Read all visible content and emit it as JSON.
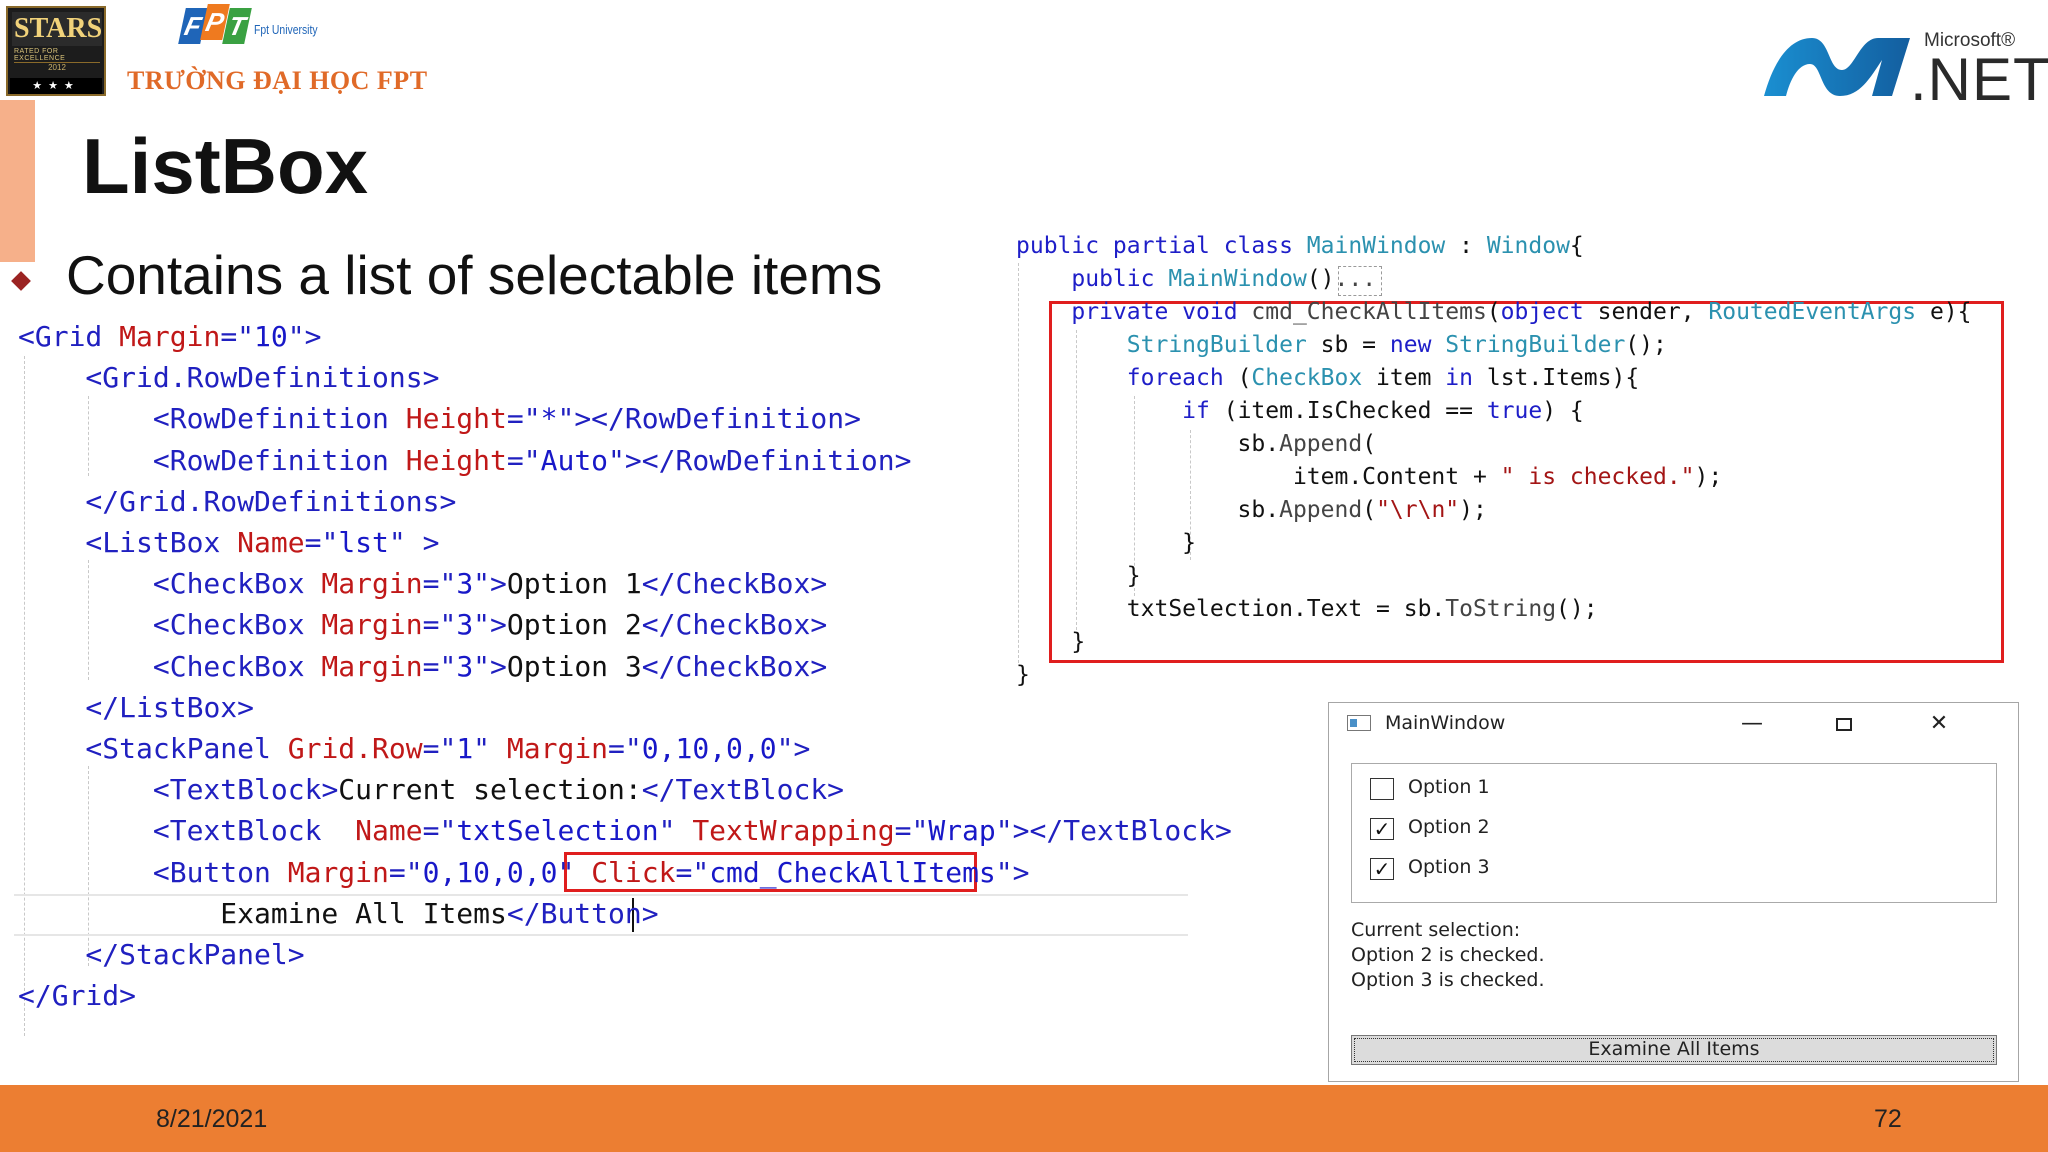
{
  "header": {
    "stars_logo": {
      "text": "STARS",
      "subtext": "RATED FOR EXCELLENCE",
      "year": "2012",
      "stars": "★★★"
    },
    "fpt_logo": {
      "letters": [
        "F",
        "P",
        "T"
      ],
      "university": "Fpt University",
      "school_name": "TRƯỜNG ĐẠI HỌC FPT"
    },
    "dotnet_logo": {
      "company": "Microsoft®",
      "product": ".NET"
    }
  },
  "slide": {
    "title": "ListBox",
    "bullet": "Contains a list of selectable items"
  },
  "xaml_code": [
    [
      {
        "t": "<",
        "c": "tg"
      },
      {
        "t": "Grid",
        "c": "tg"
      },
      {
        "t": " Margin",
        "c": "an"
      },
      {
        "t": "=\"",
        "c": "tg"
      },
      {
        "t": "10",
        "c": "av"
      },
      {
        "t": "\">",
        "c": "tg"
      }
    ],
    [
      {
        "t": "    <",
        "c": "tg"
      },
      {
        "t": "Grid.RowDefinitions",
        "c": "tg"
      },
      {
        "t": ">",
        "c": "tg"
      }
    ],
    [
      {
        "t": "        <",
        "c": "tg"
      },
      {
        "t": "RowDefinition",
        "c": "tg"
      },
      {
        "t": " Height",
        "c": "an"
      },
      {
        "t": "=\"",
        "c": "tg"
      },
      {
        "t": "*",
        "c": "av"
      },
      {
        "t": "\"></",
        "c": "tg"
      },
      {
        "t": "RowDefinition",
        "c": "tg"
      },
      {
        "t": ">",
        "c": "tg"
      }
    ],
    [
      {
        "t": "        <",
        "c": "tg"
      },
      {
        "t": "RowDefinition",
        "c": "tg"
      },
      {
        "t": " Height",
        "c": "an"
      },
      {
        "t": "=\"",
        "c": "tg"
      },
      {
        "t": "Auto",
        "c": "av"
      },
      {
        "t": "\"></",
        "c": "tg"
      },
      {
        "t": "RowDefinition",
        "c": "tg"
      },
      {
        "t": ">",
        "c": "tg"
      }
    ],
    [
      {
        "t": "    </",
        "c": "tg"
      },
      {
        "t": "Grid.RowDefinitions",
        "c": "tg"
      },
      {
        "t": ">",
        "c": "tg"
      }
    ],
    [
      {
        "t": "    <",
        "c": "tg"
      },
      {
        "t": "ListBox",
        "c": "tg"
      },
      {
        "t": " Name",
        "c": "an"
      },
      {
        "t": "=\"",
        "c": "tg"
      },
      {
        "t": "lst",
        "c": "av"
      },
      {
        "t": "\" >",
        "c": "tg"
      }
    ],
    [
      {
        "t": "        <",
        "c": "tg"
      },
      {
        "t": "CheckBox",
        "c": "tg"
      },
      {
        "t": " Margin",
        "c": "an"
      },
      {
        "t": "=\"",
        "c": "tg"
      },
      {
        "t": "3",
        "c": "av"
      },
      {
        "t": "\">",
        "c": "tg"
      },
      {
        "t": "Option 1",
        "c": "tx"
      },
      {
        "t": "</",
        "c": "tg"
      },
      {
        "t": "CheckBox",
        "c": "tg"
      },
      {
        "t": ">",
        "c": "tg"
      }
    ],
    [
      {
        "t": "        <",
        "c": "tg"
      },
      {
        "t": "CheckBox",
        "c": "tg"
      },
      {
        "t": " Margin",
        "c": "an"
      },
      {
        "t": "=\"",
        "c": "tg"
      },
      {
        "t": "3",
        "c": "av"
      },
      {
        "t": "\">",
        "c": "tg"
      },
      {
        "t": "Option 2",
        "c": "tx"
      },
      {
        "t": "</",
        "c": "tg"
      },
      {
        "t": "CheckBox",
        "c": "tg"
      },
      {
        "t": ">",
        "c": "tg"
      }
    ],
    [
      {
        "t": "        <",
        "c": "tg"
      },
      {
        "t": "CheckBox",
        "c": "tg"
      },
      {
        "t": " Margin",
        "c": "an"
      },
      {
        "t": "=\"",
        "c": "tg"
      },
      {
        "t": "3",
        "c": "av"
      },
      {
        "t": "\">",
        "c": "tg"
      },
      {
        "t": "Option 3",
        "c": "tx"
      },
      {
        "t": "</",
        "c": "tg"
      },
      {
        "t": "CheckBox",
        "c": "tg"
      },
      {
        "t": ">",
        "c": "tg"
      }
    ],
    [
      {
        "t": "    </",
        "c": "tg"
      },
      {
        "t": "ListBox",
        "c": "tg"
      },
      {
        "t": ">",
        "c": "tg"
      }
    ],
    [
      {
        "t": "    <",
        "c": "tg"
      },
      {
        "t": "StackPanel",
        "c": "tg"
      },
      {
        "t": " Grid.Row",
        "c": "an"
      },
      {
        "t": "=\"",
        "c": "tg"
      },
      {
        "t": "1",
        "c": "av"
      },
      {
        "t": "\"",
        "c": "tg"
      },
      {
        "t": " Margin",
        "c": "an"
      },
      {
        "t": "=\"",
        "c": "tg"
      },
      {
        "t": "0,10,0,0",
        "c": "av"
      },
      {
        "t": "\">",
        "c": "tg"
      }
    ],
    [
      {
        "t": "        <",
        "c": "tg"
      },
      {
        "t": "TextBlock",
        "c": "tg"
      },
      {
        "t": ">",
        "c": "tg"
      },
      {
        "t": "Current selection:",
        "c": "tx"
      },
      {
        "t": "</",
        "c": "tg"
      },
      {
        "t": "TextBlock",
        "c": "tg"
      },
      {
        "t": ">",
        "c": "tg"
      }
    ],
    [
      {
        "t": "        <",
        "c": "tg"
      },
      {
        "t": "TextBlock",
        "c": "tg"
      },
      {
        "t": "  Name",
        "c": "an"
      },
      {
        "t": "=\"",
        "c": "tg"
      },
      {
        "t": "txtSelection",
        "c": "av"
      },
      {
        "t": "\"",
        "c": "tg"
      },
      {
        "t": " TextWrapping",
        "c": "an"
      },
      {
        "t": "=\"",
        "c": "tg"
      },
      {
        "t": "Wrap",
        "c": "av"
      },
      {
        "t": "\"></",
        "c": "tg"
      },
      {
        "t": "TextBlock",
        "c": "tg"
      },
      {
        "t": ">",
        "c": "tg"
      }
    ],
    [
      {
        "t": "        <",
        "c": "tg"
      },
      {
        "t": "Button",
        "c": "tg"
      },
      {
        "t": " Margin",
        "c": "an"
      },
      {
        "t": "=\"",
        "c": "tg"
      },
      {
        "t": "0,10,0,0",
        "c": "av"
      },
      {
        "t": "\" ",
        "c": "tg"
      },
      {
        "t": "Click",
        "c": "an"
      },
      {
        "t": "=\"",
        "c": "tg"
      },
      {
        "t": "cmd_CheckAllItems",
        "c": "av"
      },
      {
        "t": "\"",
        "c": "tg"
      },
      {
        "t": ">",
        "c": "tg"
      }
    ],
    [
      {
        "t": "            Examine All Items",
        "c": "tx"
      },
      {
        "t": "</",
        "c": "tg"
      },
      {
        "t": "Button",
        "c": "tg"
      },
      {
        "t": ">",
        "c": "tg"
      }
    ],
    [
      {
        "t": "    </",
        "c": "tg"
      },
      {
        "t": "StackPanel",
        "c": "tg"
      },
      {
        "t": ">",
        "c": "tg"
      }
    ],
    [
      {
        "t": "</",
        "c": "tg"
      },
      {
        "t": "Grid",
        "c": "tg"
      },
      {
        "t": ">",
        "c": "tg"
      }
    ]
  ],
  "csharp_code": [
    [
      {
        "t": "public partial class ",
        "c": "kw"
      },
      {
        "t": "MainWindow",
        "c": "ty"
      },
      {
        "t": " : ",
        "c": "tx"
      },
      {
        "t": "Window",
        "c": "ty"
      },
      {
        "t": "{",
        "c": "tx"
      }
    ],
    [
      {
        "t": "    public ",
        "c": "kw"
      },
      {
        "t": "MainWindow",
        "c": "ty"
      },
      {
        "t": "()",
        "c": "tx"
      },
      {
        "t": "...",
        "c": "me"
      }
    ],
    [
      {
        "t": "    private void ",
        "c": "kw"
      },
      {
        "t": "cmd_CheckAllItems",
        "c": "me"
      },
      {
        "t": "(",
        "c": "tx"
      },
      {
        "t": "object",
        "c": "kw"
      },
      {
        "t": " sender, ",
        "c": "tx"
      },
      {
        "t": "RoutedEventArgs",
        "c": "ty"
      },
      {
        "t": " e){",
        "c": "tx"
      }
    ],
    [
      {
        "t": "        ",
        "c": "tx"
      },
      {
        "t": "StringBuilder",
        "c": "ty"
      },
      {
        "t": " sb = ",
        "c": "tx"
      },
      {
        "t": "new ",
        "c": "kw"
      },
      {
        "t": "StringBuilder",
        "c": "ty"
      },
      {
        "t": "();",
        "c": "tx"
      }
    ],
    [
      {
        "t": "        ",
        "c": "tx"
      },
      {
        "t": "foreach",
        "c": "kw"
      },
      {
        "t": " (",
        "c": "tx"
      },
      {
        "t": "CheckBox",
        "c": "ty"
      },
      {
        "t": " item ",
        "c": "tx"
      },
      {
        "t": "in",
        "c": "kw"
      },
      {
        "t": " lst.Items){",
        "c": "tx"
      }
    ],
    [
      {
        "t": "            ",
        "c": "tx"
      },
      {
        "t": "if",
        "c": "kw"
      },
      {
        "t": " (item.IsChecked == ",
        "c": "tx"
      },
      {
        "t": "true",
        "c": "kw"
      },
      {
        "t": ") {",
        "c": "tx"
      }
    ],
    [
      {
        "t": "                sb.",
        "c": "tx"
      },
      {
        "t": "Append",
        "c": "me"
      },
      {
        "t": "(",
        "c": "tx"
      }
    ],
    [
      {
        "t": "                    item.Content + ",
        "c": "tx"
      },
      {
        "t": "\" is checked.\"",
        "c": "st"
      },
      {
        "t": ");",
        "c": "tx"
      }
    ],
    [
      {
        "t": "                sb.",
        "c": "tx"
      },
      {
        "t": "Append",
        "c": "me"
      },
      {
        "t": "(",
        "c": "tx"
      },
      {
        "t": "\"\\r\\n\"",
        "c": "st"
      },
      {
        "t": ");",
        "c": "tx"
      }
    ],
    [
      {
        "t": "            }",
        "c": "tx"
      }
    ],
    [
      {
        "t": "        }",
        "c": "tx"
      }
    ],
    [
      {
        "t": "        txtSelection.Text = sb.",
        "c": "tx"
      },
      {
        "t": "ToString",
        "c": "me"
      },
      {
        "t": "();",
        "c": "tx"
      }
    ],
    [
      {
        "t": "    }",
        "c": "tx"
      }
    ],
    [
      {
        "t": "}",
        "c": "tx"
      }
    ]
  ],
  "wpf_window": {
    "title": "MainWindow",
    "controls": {
      "minimize": "—",
      "maximize": "",
      "close": "✕"
    },
    "options": [
      {
        "label": "Option 1",
        "checked": false
      },
      {
        "label": "Option 2",
        "checked": true
      },
      {
        "label": "Option 3",
        "checked": true
      }
    ],
    "selection_label": "Current selection:",
    "selection_lines": [
      "Option 2 is checked.",
      "Option 3 is checked."
    ],
    "button_label": "Examine All Items"
  },
  "footer": {
    "date": "8/21/2021",
    "page": "72"
  },
  "colors": {
    "footer": "#ec7e32",
    "accent_bar": "#f6b08a",
    "highlight_box": "#e01e1e",
    "bullet": "#9b2322"
  }
}
